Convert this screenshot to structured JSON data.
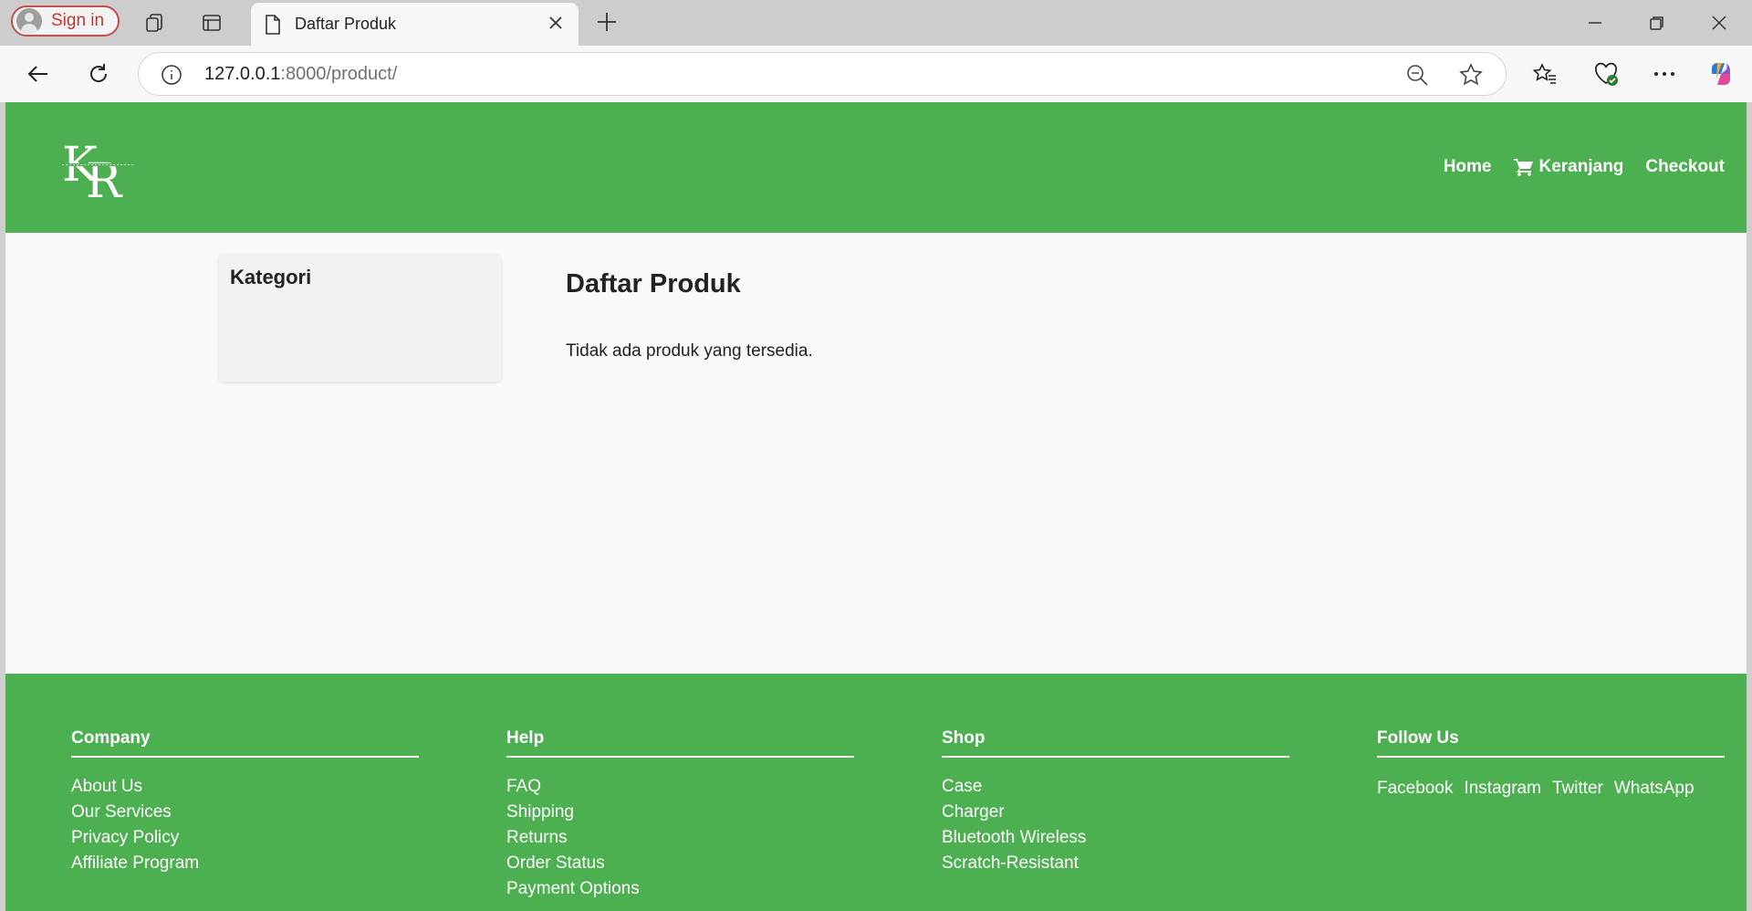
{
  "browser": {
    "signin_label": "Sign in",
    "tab_title": "Daftar Produk",
    "url_host": "127.0.0.1",
    "url_rest": ":8000/product/"
  },
  "header": {
    "nav": {
      "home": "Home",
      "cart": "Keranjang",
      "checkout": "Checkout"
    }
  },
  "sidebar": {
    "title": "Kategori"
  },
  "main": {
    "title": "Daftar Produk",
    "empty_message": "Tidak ada produk yang tersedia."
  },
  "footer": {
    "columns": [
      {
        "title": "Company",
        "items": [
          "About Us",
          "Our Services",
          "Privacy Policy",
          "Affiliate Program"
        ]
      },
      {
        "title": "Help",
        "items": [
          "FAQ",
          "Shipping",
          "Returns",
          "Order Status",
          "Payment Options"
        ]
      },
      {
        "title": "Shop",
        "items": [
          "Case",
          "Charger",
          "Bluetooth Wireless",
          "Scratch-Resistant"
        ]
      }
    ],
    "follow": {
      "title": "Follow Us",
      "links": [
        "Facebook",
        "Instagram",
        "Twitter",
        "WhatsApp"
      ]
    }
  },
  "colors": {
    "brand_green": "#4caf50"
  },
  "icons": [
    "profile-icon",
    "workspaces-icon",
    "tab-actions-icon",
    "page-icon",
    "close-tab-icon",
    "new-tab-icon",
    "minimize-icon",
    "restore-icon",
    "close-window-icon",
    "back-icon",
    "refresh-icon",
    "site-info-icon",
    "zoom-out-icon",
    "favorite-star-icon",
    "favorites-icon",
    "browser-essentials-icon",
    "more-icon",
    "copilot-icon",
    "cart-icon"
  ]
}
